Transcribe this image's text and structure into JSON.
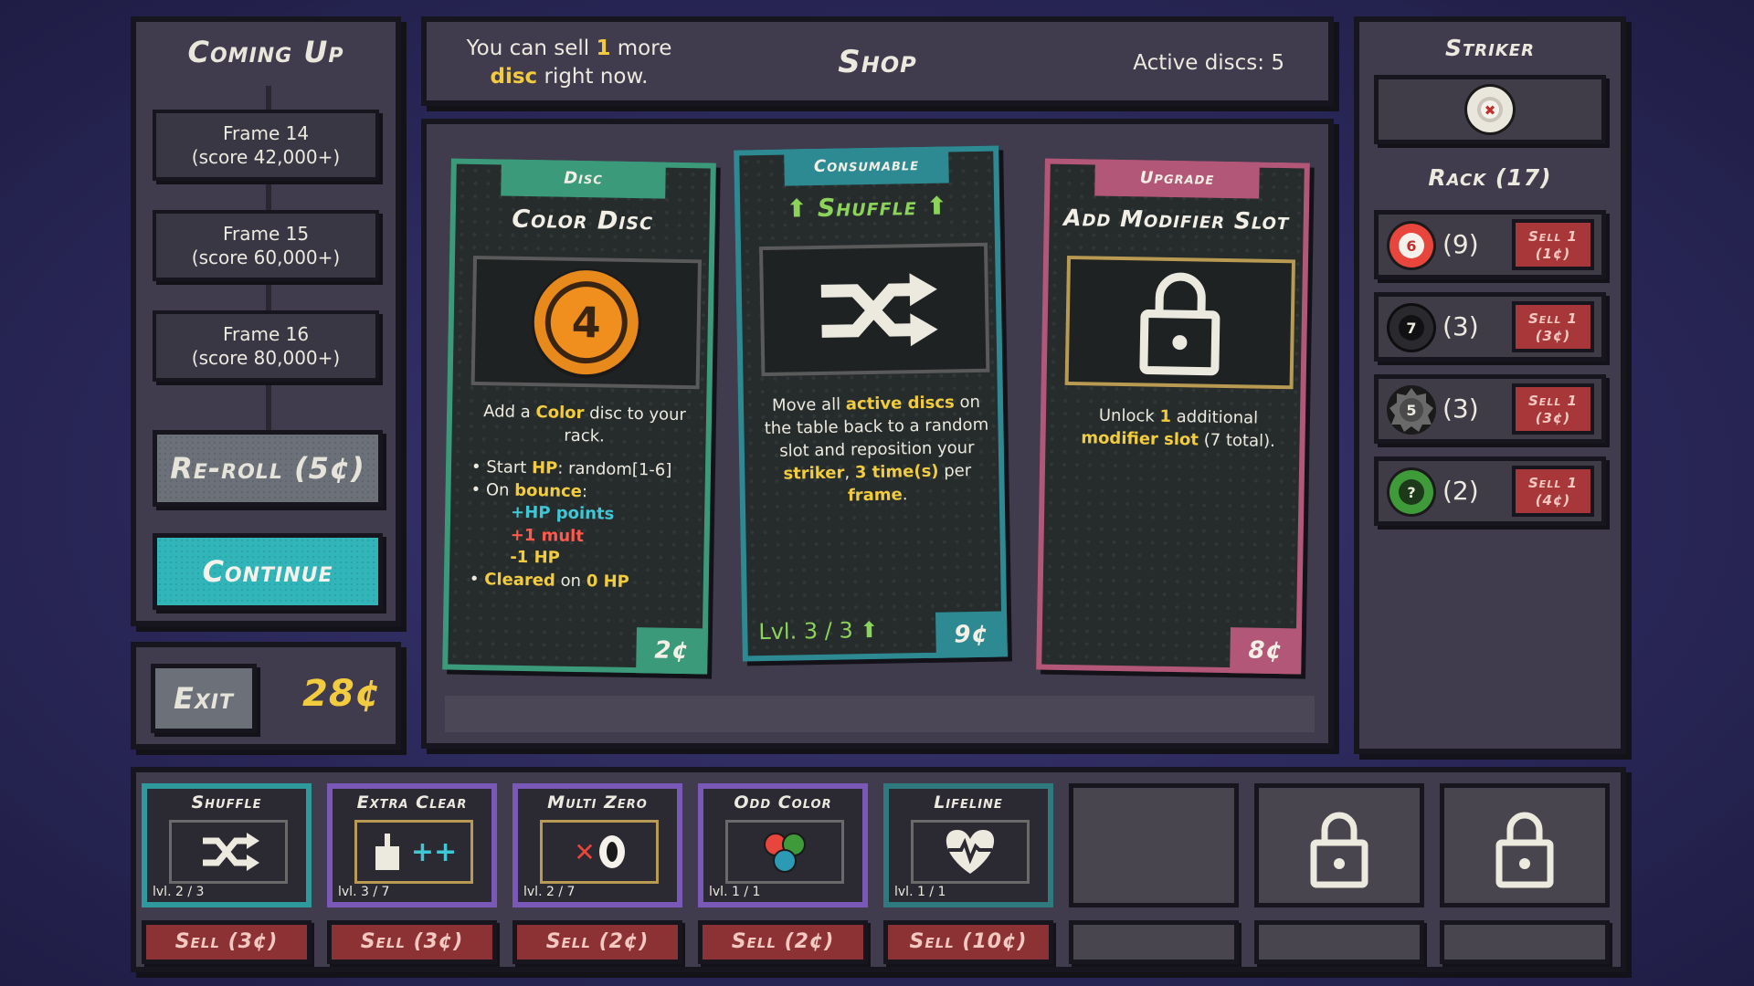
{
  "coming_up": {
    "title": "Coming Up",
    "frames": [
      {
        "line1": "Frame 14",
        "line2": "(score 42,000+)"
      },
      {
        "line1": "Frame 15",
        "line2": "(score 60,000+)"
      },
      {
        "line1": "Frame 16",
        "line2": "(score 80,000+)"
      }
    ],
    "reroll_label": "Re-roll (5¢)",
    "continue_label": "Continue"
  },
  "footer_left": {
    "exit_label": "Exit",
    "money": "28¢"
  },
  "shop": {
    "sell_info_pre": "You can sell ",
    "sell_info_num": "1",
    "sell_info_mid": " more",
    "sell_info_word": "disc",
    "sell_info_post": " right now.",
    "title": "Shop",
    "active_discs": "Active discs: 5",
    "cards": [
      {
        "tag": "Disc",
        "name": "Color Disc",
        "disc_number": "4",
        "desc_a": "Add a ",
        "desc_b": "Color",
        "desc_c": " disc to your rack.",
        "list": {
          "l1a": "• Start ",
          "l1b": "HP",
          "l1c": ": random[1-6]",
          "l2a": "• On ",
          "l2b": "bounce",
          "l2c": ":",
          "l3": "+HP points",
          "l4": "+1 mult",
          "l5": "-1 HP",
          "l6a": "• ",
          "l6b": "Cleared",
          "l6c": " on ",
          "l6d": "0 HP"
        },
        "price": "2¢"
      },
      {
        "tag": "Consumable",
        "name": "Shuffle",
        "desc_a": "Move all ",
        "desc_b": "active discs",
        "desc_c": " on the table back to a random slot and reposition your ",
        "desc_d": "striker",
        "desc_e": ", ",
        "desc_f": "3 time(s)",
        "desc_g": " per ",
        "desc_h": "frame",
        "desc_i": ".",
        "level": "Lvl. 3 / 3",
        "price": "9¢"
      },
      {
        "tag": "Upgrade",
        "name": "Add Modifier Slot",
        "desc_a": "Unlock ",
        "desc_b": "1",
        "desc_c": " additional ",
        "desc_d": "modifier slot",
        "desc_e": " (7 total).",
        "price": "8¢"
      }
    ]
  },
  "right_panel": {
    "striker_title": "Striker",
    "rack_title": "Rack (17)",
    "rack": [
      {
        "ball": "6",
        "count": "(9)",
        "sell_l1": "Sell 1",
        "sell_l2": "(1¢)",
        "color": "#e8453c"
      },
      {
        "ball": "7",
        "count": "(3)",
        "sell_l1": "Sell 1",
        "sell_l2": "(3¢)",
        "color": "#1e1e22"
      },
      {
        "ball": "5",
        "count": "(3)",
        "sell_l1": "Sell 1",
        "sell_l2": "(3¢)",
        "color": "#5e5e5e"
      },
      {
        "ball": "?",
        "count": "(2)",
        "sell_l1": "Sell 1",
        "sell_l2": "(4¢)",
        "color": "#3f9a3a"
      }
    ]
  },
  "modifiers": [
    {
      "name": "Shuffle",
      "level": "lvl. 2 / 3",
      "sell": "Sell (3¢)",
      "border": "#2e9a9e",
      "icon": "shuffle-icon"
    },
    {
      "name": "Extra Clear",
      "level": "lvl. 3 / 7",
      "sell": "Sell (3¢)",
      "border": "#7a58b8",
      "icon": "broom-plus-icon"
    },
    {
      "name": "Multi Zero",
      "level": "lvl. 2 / 7",
      "sell": "Sell (2¢)",
      "border": "#7a58b8",
      "icon": "times-zero-icon"
    },
    {
      "name": "Odd Color",
      "level": "lvl. 1 / 1",
      "sell": "Sell (2¢)",
      "border": "#7a58b8",
      "icon": "color-balls-icon"
    },
    {
      "name": "Lifeline",
      "level": "lvl. 1 / 1",
      "sell": "Sell (10¢)",
      "border": "#2e7a7e",
      "icon": "heartbeat-icon"
    }
  ]
}
